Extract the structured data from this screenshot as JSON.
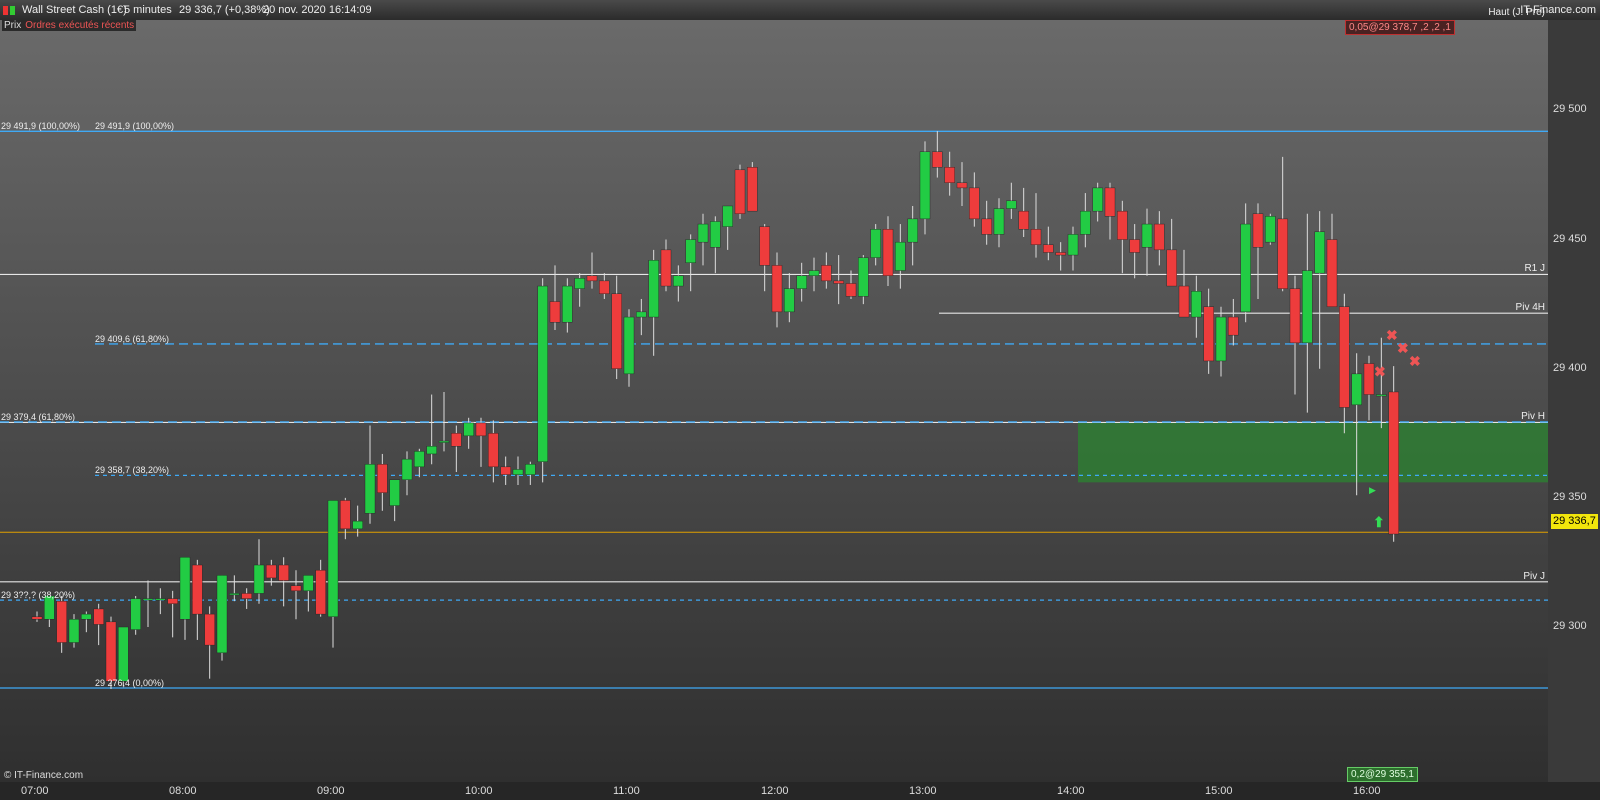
{
  "titlebar": {
    "instrument": "Wall Street Cash (1€)",
    "timeframe": "5 minutes",
    "quote": "29 336,7 (+0,38%)",
    "datetime": "20 nov. 2020 16:14:09",
    "brand": "IT-Finance.com"
  },
  "tabs": {
    "price": "Prix",
    "orders": "Ordres exécutés récents"
  },
  "copyright": "© IT-Finance.com",
  "current_price": "29 336,7",
  "order_top": "0,05@29 378,7 ,2 ,2 ,1",
  "order_bottom": "0,2@29 355,1",
  "price_ticks": [
    {
      "label": "29 500",
      "value": 29500
    },
    {
      "label": "29 450",
      "value": 29450
    },
    {
      "label": "29 400",
      "value": 29400
    },
    {
      "label": "29 350",
      "value": 29350
    },
    {
      "label": "29 300",
      "value": 29300
    }
  ],
  "time_ticks": [
    "07:00",
    "08:00",
    "09:00",
    "10:00",
    "11:00",
    "12:00",
    "13:00",
    "14:00",
    "15:00",
    "16:00"
  ],
  "levels": [
    {
      "label": "29 491,9 (100,00%)",
      "label2": "29 491,9 (100,00%)",
      "price": 29491.9,
      "style": "fib"
    },
    {
      "label": "",
      "label2": "29 409,6 (61,80%)",
      "price": 29409.6,
      "style": "dash"
    },
    {
      "label": "29 379,4 (61,80%)",
      "label2": "",
      "price": 29379.4,
      "style": "dash"
    },
    {
      "label": "",
      "label2": "29 358,7 (38,20%)",
      "price": 29358.7,
      "style": "dash"
    },
    {
      "label": "29 3??,? (38,20%)",
      "label2": "",
      "price": 29310.4,
      "style": "dash"
    },
    {
      "label": "",
      "label2": "29 276,4 (0,00%)",
      "price": 29276.4,
      "style": "fib"
    }
  ],
  "right_tags": [
    {
      "label": "Haut (J. Pre)",
      "price": 29535.6
    },
    {
      "label": "R1 J",
      "price": 29436.5
    },
    {
      "label": "Piv 4H",
      "price": 29421.5
    },
    {
      "label": "Piv H",
      "price": 29379.2
    },
    {
      "label": "Piv J",
      "price": 29317.5
    }
  ],
  "colors": {
    "up": "#22cc44",
    "down": "#ee3c3c",
    "grid": "#eeeeee",
    "fib": "#3fa9f5",
    "current": "#e0a000",
    "zone": "#2e7d32"
  },
  "chart_data": {
    "type": "candlestick",
    "interval": "5 minutes",
    "y_axis": {
      "min": 29240,
      "max": 29535
    },
    "current_price": 29336.7,
    "candles": [
      [
        "07:00",
        29304,
        29306,
        29302,
        29303
      ],
      [
        "07:05",
        29303,
        29312,
        29300,
        29312
      ],
      [
        "07:10",
        29310,
        29312,
        29290,
        29294
      ],
      [
        "07:15",
        29294,
        29305,
        29292,
        29303
      ],
      [
        "07:20",
        29303,
        29306,
        29298,
        29305
      ],
      [
        "07:25",
        29307,
        29309,
        29293,
        29301
      ],
      [
        "07:30",
        29302,
        29304,
        29276,
        29279
      ],
      [
        "07:35",
        29279,
        29298,
        29277,
        29300
      ],
      [
        "07:40",
        29299,
        29312,
        29297,
        29311
      ],
      [
        "07:45",
        29311,
        29318,
        29300,
        29311
      ],
      [
        "07:50",
        29311,
        29315,
        29305,
        29311
      ],
      [
        "07:55",
        29311,
        29314,
        29296,
        29309
      ],
      [
        "08:00",
        29303,
        29320,
        29295,
        29327
      ],
      [
        "08:05",
        29324,
        29326,
        29295,
        29305
      ],
      [
        "08:10",
        29305,
        29308,
        29280,
        29293
      ],
      [
        "08:15",
        29290,
        29320,
        29287,
        29320
      ],
      [
        "08:20",
        29313,
        29320,
        29310,
        29313
      ],
      [
        "08:25",
        29313,
        29315,
        29307,
        29311
      ],
      [
        "08:30",
        29313,
        29334,
        29309,
        29324
      ],
      [
        "08:35",
        29324,
        29326,
        29316,
        29319
      ],
      [
        "08:40",
        29324,
        29327,
        29308,
        29318
      ],
      [
        "08:45",
        29316,
        29322,
        29303,
        29314
      ],
      [
        "08:50",
        29314,
        29318,
        29306,
        29320
      ],
      [
        "08:55",
        29322,
        29326,
        29304,
        29305
      ],
      [
        "09:00",
        29304,
        29348,
        29292,
        29349
      ],
      [
        "09:05",
        29349,
        29350,
        29334,
        29338
      ],
      [
        "09:10",
        29338,
        29347,
        29335,
        29341
      ],
      [
        "09:15",
        29344,
        29378,
        29340,
        29363
      ],
      [
        "09:20",
        29363,
        29367,
        29345,
        29352
      ],
      [
        "09:25",
        29347,
        29353,
        29341,
        29357
      ],
      [
        "09:30",
        29357,
        29368,
        29351,
        29365
      ],
      [
        "09:35",
        29362,
        29369,
        29358,
        29368
      ],
      [
        "09:40",
        29367,
        29390,
        29363,
        29370
      ],
      [
        "09:45",
        29372,
        29391,
        29368,
        29372
      ],
      [
        "09:50",
        29375,
        29378,
        29360,
        29370
      ],
      [
        "09:55",
        29374,
        29381,
        29369,
        29379
      ],
      [
        "10:00",
        29379,
        29381,
        29362,
        29374
      ],
      [
        "10:05",
        29375,
        29380,
        29356,
        29362
      ],
      [
        "10:10",
        29362,
        29366,
        29355,
        29359
      ],
      [
        "10:15",
        29359,
        29366,
        29355,
        29361
      ],
      [
        "10:20",
        29359,
        29364,
        29355,
        29363
      ],
      [
        "10:25",
        29364,
        29435,
        29356,
        29432
      ],
      [
        "10:30",
        29426,
        29440,
        29415,
        29418
      ],
      [
        "10:35",
        29418,
        29435,
        29414,
        29432
      ],
      [
        "10:40",
        29431,
        29437,
        29424,
        29435
      ],
      [
        "10:45",
        29436,
        29445,
        29431,
        29434
      ],
      [
        "10:50",
        29434,
        29437,
        29427,
        29429
      ],
      [
        "10:55",
        29429,
        29436,
        29396,
        29400
      ],
      [
        "11:00",
        29398,
        29423,
        29393,
        29420
      ],
      [
        "11:05",
        29420,
        29427,
        29413,
        29422
      ],
      [
        "11:10",
        29420,
        29446,
        29405,
        29442
      ],
      [
        "11:15",
        29446,
        29450,
        29430,
        29432
      ],
      [
        "11:20",
        29432,
        29440,
        29426,
        29436
      ],
      [
        "11:25",
        29441,
        29452,
        29430,
        29450
      ],
      [
        "11:30",
        29449,
        29460,
        29440,
        29456
      ],
      [
        "11:35",
        29447,
        29459,
        29437,
        29457
      ],
      [
        "11:40",
        29455,
        29459,
        29446,
        29463
      ],
      [
        "11:45",
        29477,
        29479,
        29458,
        29460
      ],
      [
        "11:50",
        29478,
        29480,
        29462,
        29461
      ],
      [
        "11:55",
        29455,
        29456,
        29430,
        29440
      ],
      [
        "12:00",
        29440,
        29445,
        29416,
        29422
      ],
      [
        "12:05",
        29422,
        29437,
        29418,
        29431
      ],
      [
        "12:10",
        29431,
        29441,
        29426,
        29436
      ],
      [
        "12:15",
        29436,
        29443,
        29430,
        29438
      ],
      [
        "12:20",
        29440,
        29445,
        29431,
        29434
      ],
      [
        "12:25",
        29434,
        29444,
        29425,
        29433
      ],
      [
        "12:30",
        29433,
        29438,
        29427,
        29428
      ],
      [
        "12:35",
        29428,
        29444,
        29425,
        29443
      ],
      [
        "12:40",
        29443,
        29456,
        29440,
        29454
      ],
      [
        "12:45",
        29454,
        29459,
        29432,
        29436
      ],
      [
        "12:50",
        29438,
        29456,
        29431,
        29449
      ],
      [
        "12:55",
        29449,
        29463,
        29440,
        29458
      ],
      [
        "13:00",
        29458,
        29488,
        29452,
        29484
      ],
      [
        "13:05",
        29484,
        29492,
        29474,
        29478
      ],
      [
        "13:10",
        29478,
        29484,
        29467,
        29472
      ],
      [
        "13:15",
        29472,
        29480,
        29463,
        29470
      ],
      [
        "13:20",
        29470,
        29476,
        29455,
        29458
      ],
      [
        "13:25",
        29458,
        29465,
        29448,
        29452
      ],
      [
        "13:30",
        29452,
        29466,
        29447,
        29462
      ],
      [
        "13:35",
        29462,
        29472,
        29458,
        29465
      ],
      [
        "13:40",
        29461,
        29470,
        29451,
        29454
      ],
      [
        "13:45",
        29454,
        29468,
        29443,
        29448
      ],
      [
        "13:50",
        29448,
        29455,
        29442,
        29445
      ],
      [
        "13:55",
        29445,
        29449,
        29438,
        29444
      ],
      [
        "14:00",
        29444,
        29455,
        29438,
        29452
      ],
      [
        "14:05",
        29452,
        29468,
        29447,
        29461
      ],
      [
        "14:10",
        29461,
        29472,
        29457,
        29470
      ],
      [
        "14:15",
        29470,
        29472,
        29450,
        29459
      ],
      [
        "14:20",
        29461,
        29465,
        29437,
        29450
      ],
      [
        "14:25",
        29450,
        29456,
        29435,
        29445
      ],
      [
        "14:30",
        29447,
        29462,
        29436,
        29456
      ],
      [
        "14:35",
        29456,
        29461,
        29440,
        29446
      ],
      [
        "14:40",
        29446,
        29458,
        29434,
        29432
      ],
      [
        "14:45",
        29432,
        29446,
        29420,
        29420
      ],
      [
        "14:50",
        29420,
        29436,
        29412,
        29430
      ],
      [
        "14:55",
        29424,
        29431,
        29398,
        29403
      ],
      [
        "15:00",
        29403,
        29424,
        29397,
        29420
      ],
      [
        "15:05",
        29420,
        29427,
        29409,
        29413
      ],
      [
        "15:10",
        29422,
        29464,
        29418,
        29456
      ],
      [
        "15:15",
        29460,
        29464,
        29427,
        29447
      ],
      [
        "15:20",
        29449,
        29460,
        29448,
        29459
      ],
      [
        "15:25",
        29458,
        29482,
        29430,
        29431
      ],
      [
        "15:30",
        29431,
        29436,
        29390,
        29410
      ],
      [
        "15:35",
        29410,
        29460,
        29383,
        29438
      ],
      [
        "15:40",
        29437,
        29461,
        29400,
        29453
      ],
      [
        "15:45",
        29450,
        29460,
        29425,
        29424
      ],
      [
        "15:50",
        29424,
        29429,
        29375,
        29385
      ],
      [
        "15:55",
        29386,
        29406,
        29351,
        29398
      ],
      [
        "16:00",
        29402,
        29405,
        29380,
        29390
      ],
      [
        "16:05",
        29390,
        29412,
        29377,
        29390
      ],
      [
        "16:10",
        29391,
        29401,
        29333,
        29336
      ]
    ]
  }
}
